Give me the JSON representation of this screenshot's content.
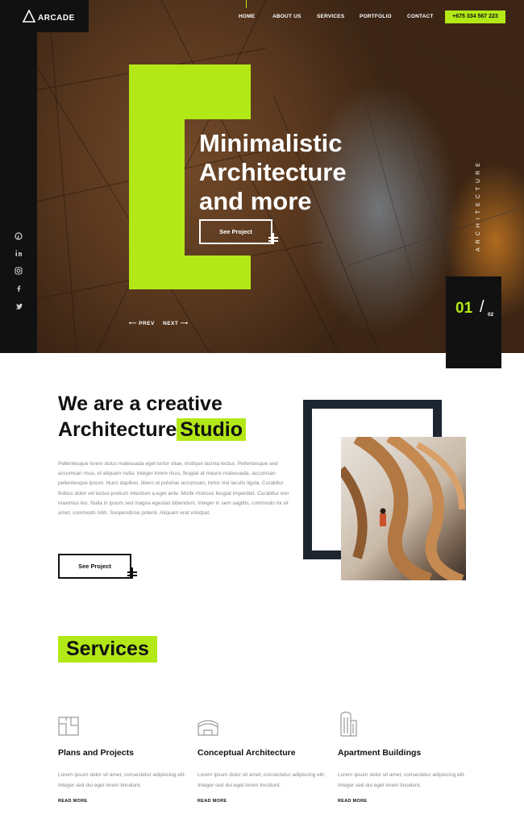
{
  "header": {
    "logo_text": "ARCADE",
    "nav": [
      "HOME",
      "ABOUT US",
      "SERVICES",
      "PORTFOLIO",
      "CONTACT"
    ],
    "phone": "+675 334 567 223"
  },
  "social_icons": [
    "pinterest-icon",
    "linkedin-icon",
    "instagram-icon",
    "facebook-icon",
    "twitter-icon"
  ],
  "hero": {
    "title": "Minimalistic\nArchitecture\nand more",
    "button_label": "See Project",
    "prev_label": "PREV",
    "next_label": "NEXT",
    "vertical_label": "ARCHITECTURE",
    "slide_current": "01",
    "slide_total": "02"
  },
  "about": {
    "title_line1": "We are a creative",
    "title_line2": "Architecture",
    "title_highlight": "Studio",
    "body": "Pellentesque lorem dolos malesuada eget tortor vitae, tristique lacinia lectus. Pellentesque sed accumsan risus, id aliquam nulla. Integer lorem risus, feugiat at mauris malesuada, accumsan pellentesque ipsum. Nunc dapibus, libero ut pulvinar accumsan, tortor nisl iaculis ligula. Curabitur finibus dolor vel lectus pretium interdum a eget ante. Morbi rhoncus feugiat imperdiet. Curabitur non maximus leo. Nulla in ipsum sed magna egestas bibendum. Integer in sem sagittis, commodo mi sit amet, commodo nibh. Suspendisse potenti. Aliquam erat volutpat.",
    "button_label": "See Project"
  },
  "services": {
    "title": "Services",
    "items": [
      {
        "icon": "plans-icon",
        "title": "Plans and Projects",
        "desc": "Lorem ipsum dolor sit amet, consectetur adipiscing elit. Integer sed dui eget lorem tincidunt.",
        "more": "READ MORE"
      },
      {
        "icon": "conceptual-icon",
        "title": "Conceptual Architecture",
        "desc": "Lorem ipsum dolor sit amet, consectetur adipiscing elit. Integer sed dui eget lorem tincidunt.",
        "more": "READ MORE"
      },
      {
        "icon": "building-icon",
        "title": "Apartment Buildings",
        "desc": "Lorem ipsum dolor sit amet, consectetur adipiscing elit. Integer sed dui eget lorem tincidunt.",
        "more": "READ MORE"
      }
    ]
  },
  "colors": {
    "accent": "#b3e817",
    "dark": "#111111",
    "navy": "#1d2630"
  }
}
